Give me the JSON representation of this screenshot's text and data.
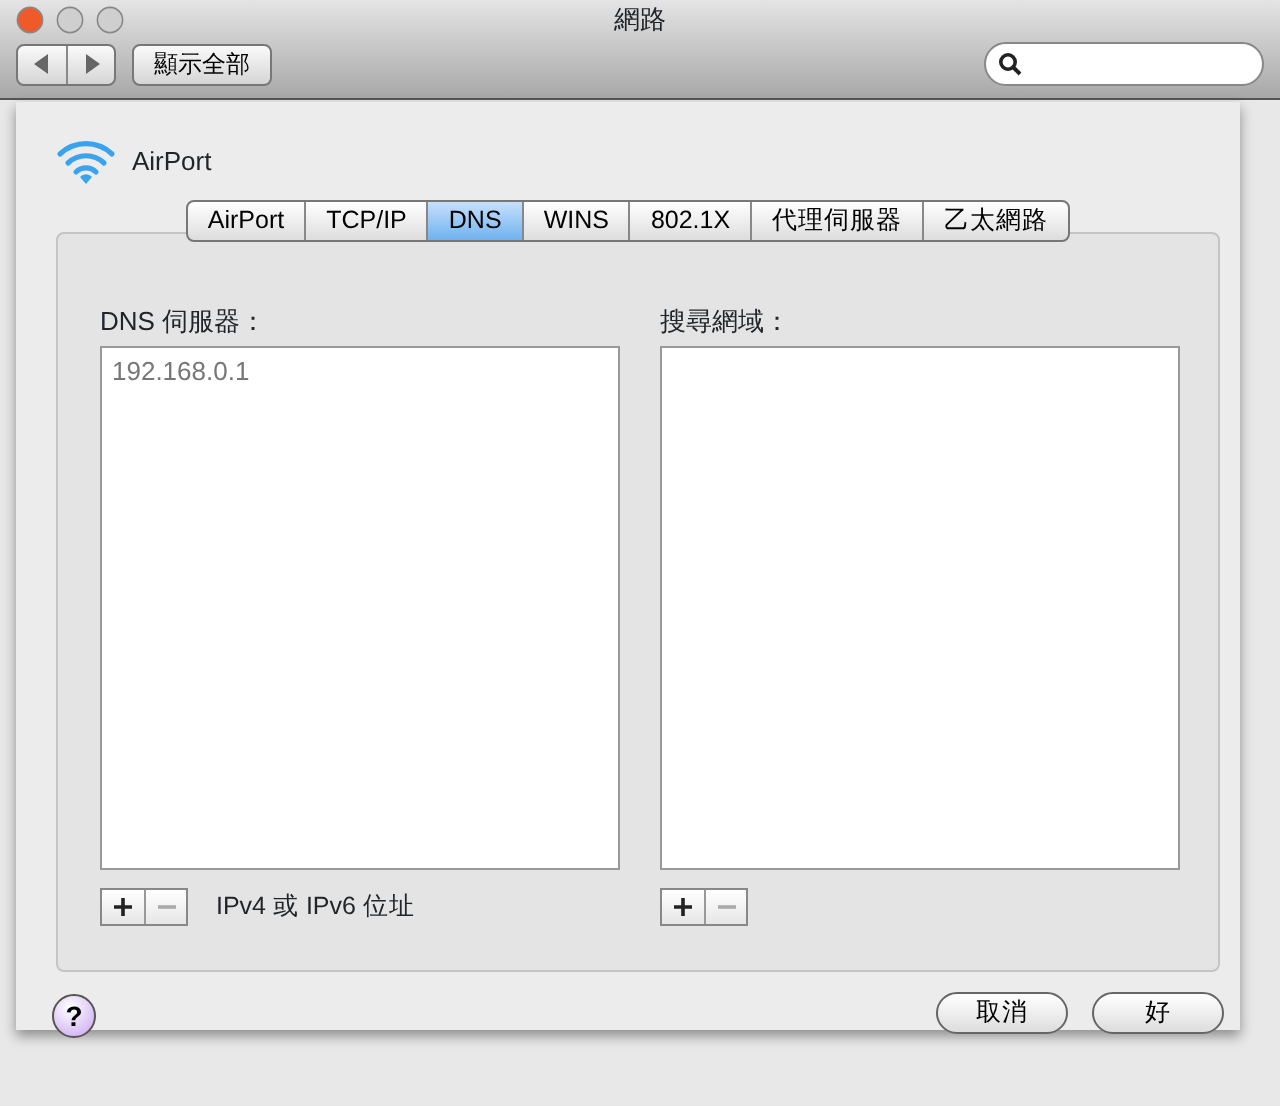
{
  "window": {
    "title": "網路"
  },
  "toolbar": {
    "show_all": "顯示全部"
  },
  "service": {
    "name": "AirPort"
  },
  "tabs": [
    {
      "label": "AirPort",
      "selected": false
    },
    {
      "label": "TCP/IP",
      "selected": false
    },
    {
      "label": "DNS",
      "selected": true
    },
    {
      "label": "WINS",
      "selected": false
    },
    {
      "label": "802.1X",
      "selected": false
    },
    {
      "label": "代理伺服器",
      "selected": false
    },
    {
      "label": "乙太網路",
      "selected": false
    }
  ],
  "lists": [
    {
      "label": "DNS 伺服器：",
      "entries": [
        "192.168.0.1"
      ],
      "add_disabled": false,
      "remove_disabled": true,
      "hint": "IPv4 或 IPv6 位址"
    },
    {
      "label": "搜尋網域：",
      "add_disabled": false,
      "remove_disabled": true
    }
  ],
  "help_button": "?",
  "buttons": [
    {
      "label": "取消"
    },
    {
      "label": "好"
    }
  ]
}
